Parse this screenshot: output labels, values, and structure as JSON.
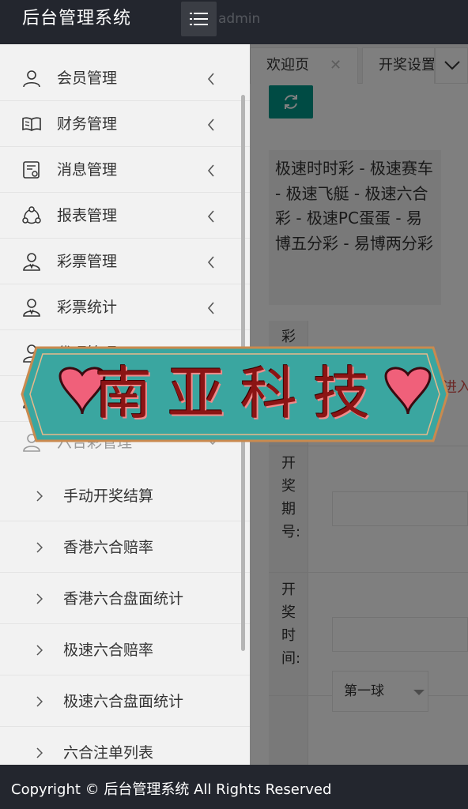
{
  "header": {
    "logo": "后台管理系统",
    "user": "admin"
  },
  "sidebar": {
    "items": [
      {
        "label": "会员管理",
        "icon": "user-icon"
      },
      {
        "label": "财务管理",
        "icon": "book-icon"
      },
      {
        "label": "消息管理",
        "icon": "message-doc-icon"
      },
      {
        "label": "报表管理",
        "icon": "cluster-icon"
      },
      {
        "label": "彩票管理",
        "icon": "user-badge-icon"
      },
      {
        "label": "彩票统计",
        "icon": "user-badge-icon"
      },
      {
        "label": "代理管理",
        "icon": "user-badge-icon"
      },
      {
        "label": "",
        "icon": "user-badge-icon"
      },
      {
        "label": "六合彩管理",
        "icon": "user-badge-icon"
      }
    ],
    "subitems": [
      {
        "label": "手动开奖结算"
      },
      {
        "label": "香港六合赔率"
      },
      {
        "label": "香港六合盘面统计"
      },
      {
        "label": "极速六合赔率"
      },
      {
        "label": "极速六合盘面统计"
      },
      {
        "label": "六合注单列表"
      }
    ]
  },
  "tabs": {
    "welcome": "欢迎页",
    "draw_settings": "开奖设置"
  },
  "content": {
    "game_types": "极速时时彩 - 极速赛车 - 极速飞艇 - 极速六合彩 - 极速PC蛋蛋 - 易博五分彩 - 易博两分彩",
    "label_game": "彩",
    "red_link": "击进入",
    "label_period": "开奖期号:",
    "label_time": "开奖时间:",
    "ball_select": "第一球"
  },
  "footer": {
    "copyright": "Copyright © 后台管理系统 All Rights Reserved"
  },
  "watermark": {
    "text": "南亚科技"
  },
  "colors": {
    "header_bg": "#23262e",
    "accent": "#009688",
    "banner_bg": "#3aa6a0",
    "banner_text": "#8b1414",
    "heart": "#f0607a"
  }
}
